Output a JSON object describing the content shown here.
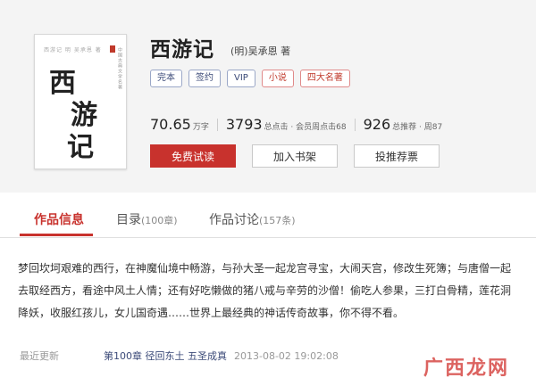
{
  "book": {
    "title": "西游记",
    "author": "(明)吴承恩 著",
    "cover": {
      "script_chars": [
        "西",
        "游",
        "记"
      ],
      "topline": "西游记 明 吴承恩 著",
      "sidetext": "中国古典文学名著"
    },
    "tags": [
      {
        "label": "完本",
        "style": "blue"
      },
      {
        "label": "签约",
        "style": "blue"
      },
      {
        "label": "VIP",
        "style": "blue"
      },
      {
        "label": "小说",
        "style": "red"
      },
      {
        "label": "四大名著",
        "style": "red"
      }
    ],
    "stats": {
      "words_value": "70.65",
      "words_label": "万字",
      "clicks_value": "3793",
      "clicks_label": "总点击 · 会员周点击68",
      "recommend_value": "926",
      "recommend_label": "总推荐 · 周87"
    },
    "buttons": {
      "read": "免费试读",
      "shelf": "加入书架",
      "recommend": "投推荐票"
    }
  },
  "tabs": [
    {
      "label": "作品信息",
      "count": ""
    },
    {
      "label": "目录",
      "count": "(100章)"
    },
    {
      "label": "作品讨论",
      "count": "(157条)"
    }
  ],
  "description": "梦回坎坷艰难的西行，在神魔仙境中畅游，与孙大圣一起龙宫寻宝，大闹天宫，修改生死簿；与唐僧一起去取经西方，看途中风土人情；还有好吃懒做的猪八戒与辛劳的沙僧！偷吃人参果，三打白骨精，莲花洞降妖，收服红孩儿，女儿国奇遇……世界上最经典的神话传奇故事，你不得不看。",
  "update": {
    "label": "最近更新",
    "chapter": "第100章  径回东土  五圣成真",
    "time": "2013-08-02 19:02:08"
  },
  "watermark": "广西龙网",
  "colors": {
    "accent": "#c8322d",
    "tag_blue": "#3b4a78",
    "panel_bg": "#f4f4f4"
  }
}
